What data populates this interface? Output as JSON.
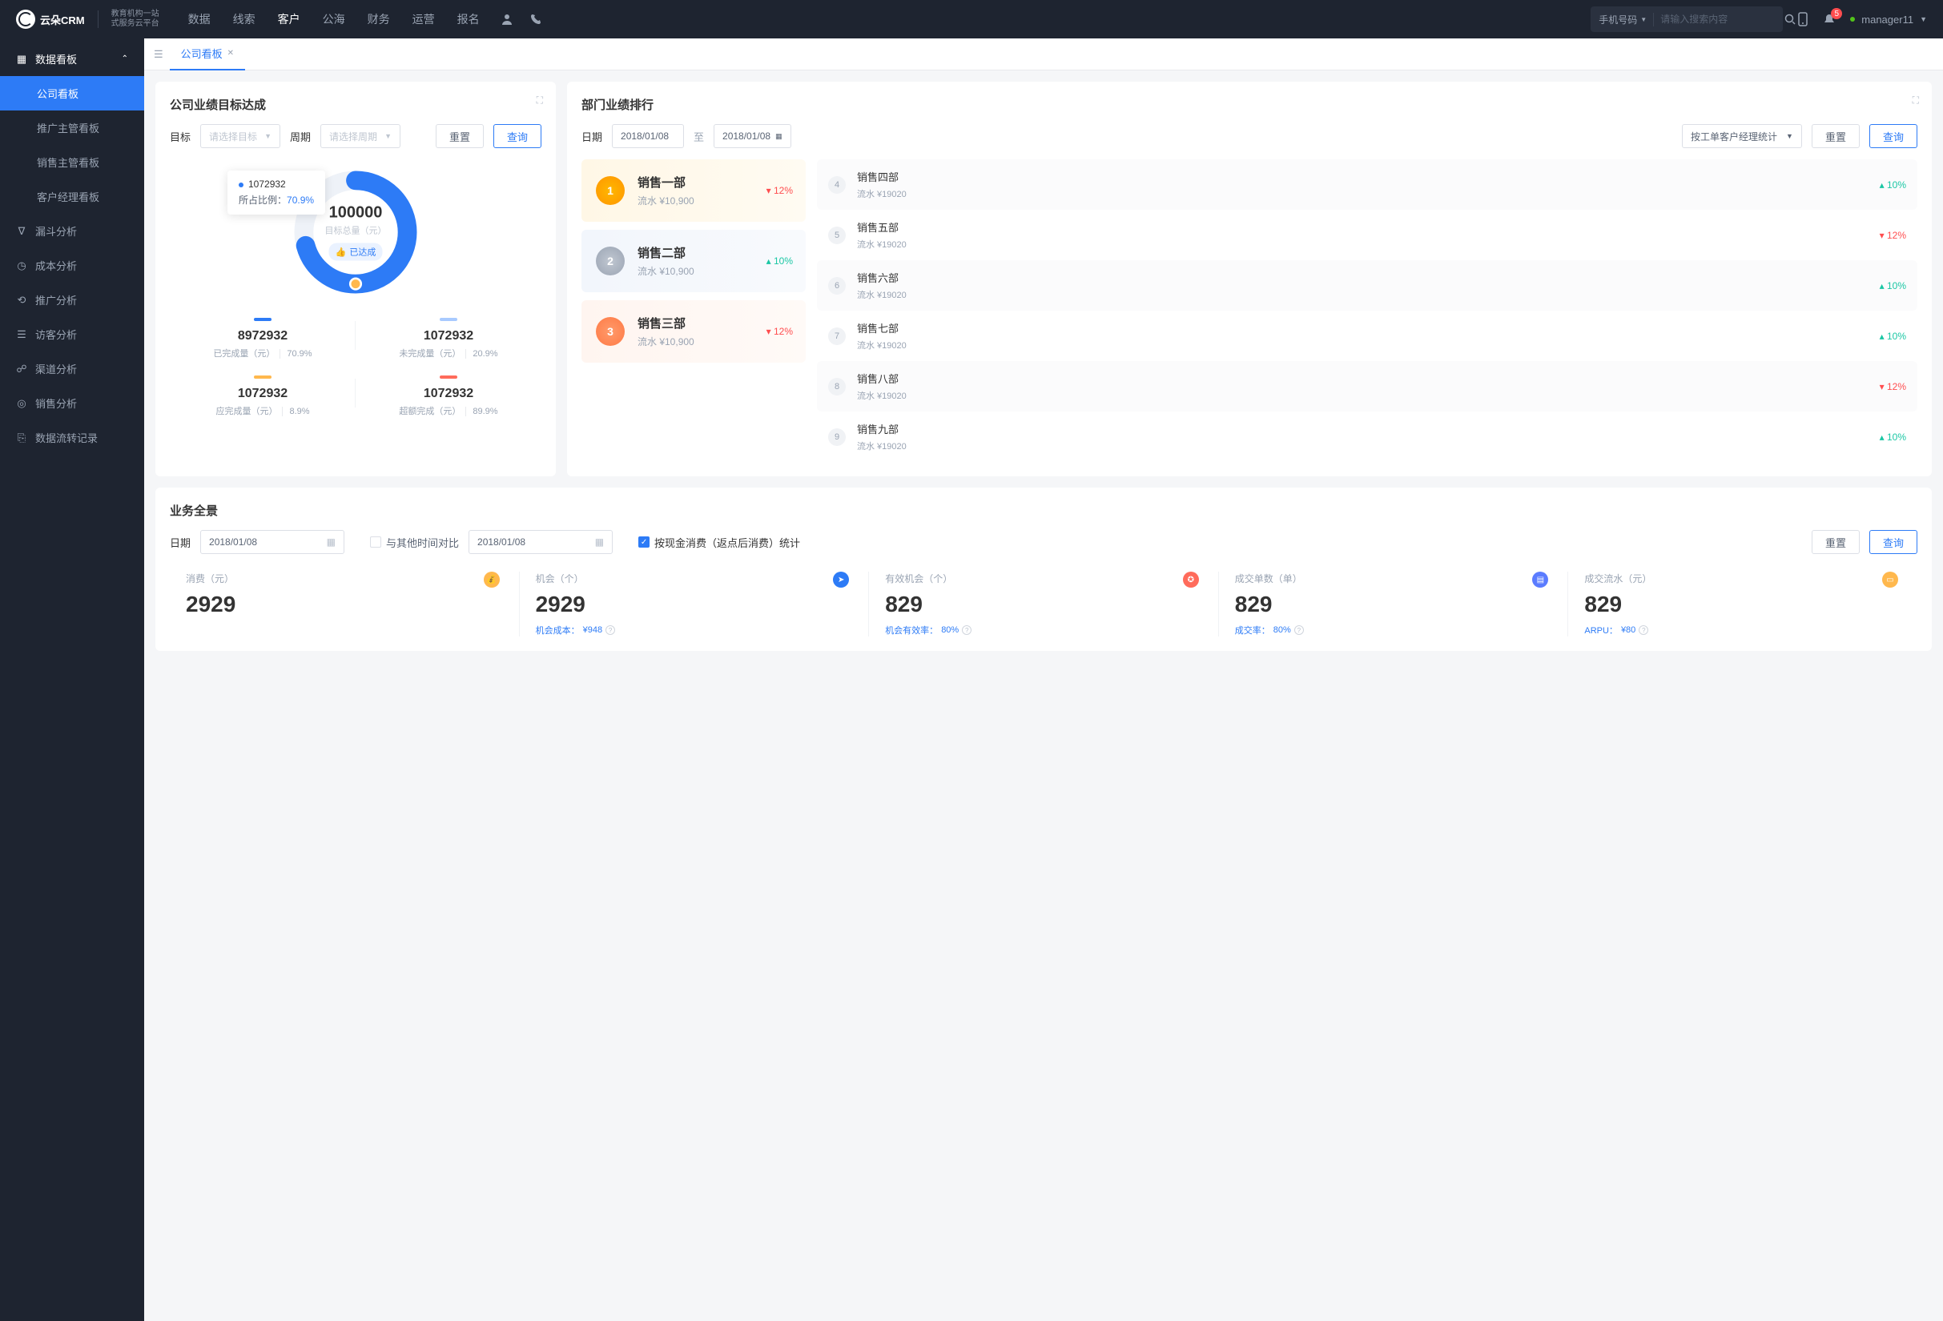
{
  "brand": {
    "name": "云朵CRM",
    "sub1": "教育机构一站",
    "sub2": "式服务云平台"
  },
  "topnav": [
    "数据",
    "线索",
    "客户",
    "公海",
    "财务",
    "运营",
    "报名"
  ],
  "topnav_active": 2,
  "search": {
    "type": "手机号码",
    "placeholder": "请输入搜索内容"
  },
  "notif_count": "5",
  "user": {
    "name": "manager11"
  },
  "sidebar": {
    "group": "数据看板",
    "subs": [
      "公司看板",
      "推广主管看板",
      "销售主管看板",
      "客户经理看板"
    ],
    "sub_active": 0,
    "items": [
      "漏斗分析",
      "成本分析",
      "推广分析",
      "访客分析",
      "渠道分析",
      "销售分析",
      "数据流转记录"
    ],
    "icons": [
      "∇",
      "◷",
      "⟲",
      "☰",
      "☍",
      "◎",
      "⎘"
    ]
  },
  "tab": {
    "label": "公司看板"
  },
  "goal": {
    "title": "公司业绩目标达成",
    "target_label": "目标",
    "target_ph": "请选择目标",
    "period_label": "周期",
    "period_ph": "请选择周期",
    "reset": "重置",
    "query": "查询",
    "center": {
      "big": "100000",
      "sm": "目标总量（元）",
      "tag": "已达成"
    },
    "tooltip": {
      "val": "1072932",
      "ratio_label": "所占比例：",
      "ratio": "70.9%"
    },
    "stats": [
      {
        "bar": "#2d7bf6",
        "num": "8972932",
        "label": "已完成量（元）",
        "pct": "70.9%"
      },
      {
        "bar": "#a8caff",
        "num": "1072932",
        "label": "未完成量（元）",
        "pct": "20.9%"
      },
      {
        "bar": "#ffb84d",
        "num": "1072932",
        "label": "应完成量（元）",
        "pct": "8.9%"
      },
      {
        "bar": "#ff6b5b",
        "num": "1072932",
        "label": "超额完成（元）",
        "pct": "89.9%"
      }
    ]
  },
  "rank": {
    "title": "部门业绩排行",
    "date_label": "日期",
    "date1": "2018/01/08",
    "to": "至",
    "date2": "2018/01/08",
    "stat_by": "按工单客户经理统计",
    "reset": "重置",
    "query": "查询",
    "top3": [
      {
        "n": "1",
        "name": "销售一部",
        "sub": "流水 ¥10,900",
        "delta": "12%",
        "dir": "down"
      },
      {
        "n": "2",
        "name": "销售二部",
        "sub": "流水 ¥10,900",
        "delta": "10%",
        "dir": "up"
      },
      {
        "n": "3",
        "name": "销售三部",
        "sub": "流水 ¥10,900",
        "delta": "12%",
        "dir": "down"
      }
    ],
    "rest": [
      {
        "n": "4",
        "name": "销售四部",
        "sub": "流水 ¥19020",
        "delta": "10%",
        "dir": "up"
      },
      {
        "n": "5",
        "name": "销售五部",
        "sub": "流水 ¥19020",
        "delta": "12%",
        "dir": "down"
      },
      {
        "n": "6",
        "name": "销售六部",
        "sub": "流水 ¥19020",
        "delta": "10%",
        "dir": "up"
      },
      {
        "n": "7",
        "name": "销售七部",
        "sub": "流水 ¥19020",
        "delta": "10%",
        "dir": "up"
      },
      {
        "n": "8",
        "name": "销售八部",
        "sub": "流水 ¥19020",
        "delta": "12%",
        "dir": "down"
      },
      {
        "n": "9",
        "name": "销售九部",
        "sub": "流水 ¥19020",
        "delta": "10%",
        "dir": "up"
      }
    ]
  },
  "overview": {
    "title": "业务全景",
    "date_label": "日期",
    "date1": "2018/01/08",
    "compare": "与其他时间对比",
    "date2": "2018/01/08",
    "check_label": "按现金消费（返点后消费）统计",
    "reset": "重置",
    "query": "查询",
    "cells": [
      {
        "label": "消费（元）",
        "val": "2929",
        "meta": "",
        "metaval": "",
        "icon": "#ffb84d",
        "ic": "💰"
      },
      {
        "label": "机会（个）",
        "val": "2929",
        "meta": "机会成本：",
        "metaval": "¥948",
        "icon": "#2d7bf6",
        "ic": "➤"
      },
      {
        "label": "有效机会（个）",
        "val": "829",
        "meta": "机会有效率：",
        "metaval": "80%",
        "icon": "#ff6b5b",
        "ic": "✪"
      },
      {
        "label": "成交单数（单）",
        "val": "829",
        "meta": "成交率：",
        "metaval": "80%",
        "icon": "#5b7cff",
        "ic": "▤"
      },
      {
        "label": "成交流水（元）",
        "val": "829",
        "meta": "ARPU：",
        "metaval": "¥80",
        "icon": "#ffb84d",
        "ic": "▭"
      }
    ]
  },
  "chart_data": {
    "type": "pie",
    "title": "目标总量（元）100000",
    "series": [
      {
        "name": "已完成量",
        "value": 70.9,
        "color": "#2d7bf6"
      },
      {
        "name": "未完成量",
        "value": 29.1,
        "color": "#eef2f8"
      }
    ]
  }
}
